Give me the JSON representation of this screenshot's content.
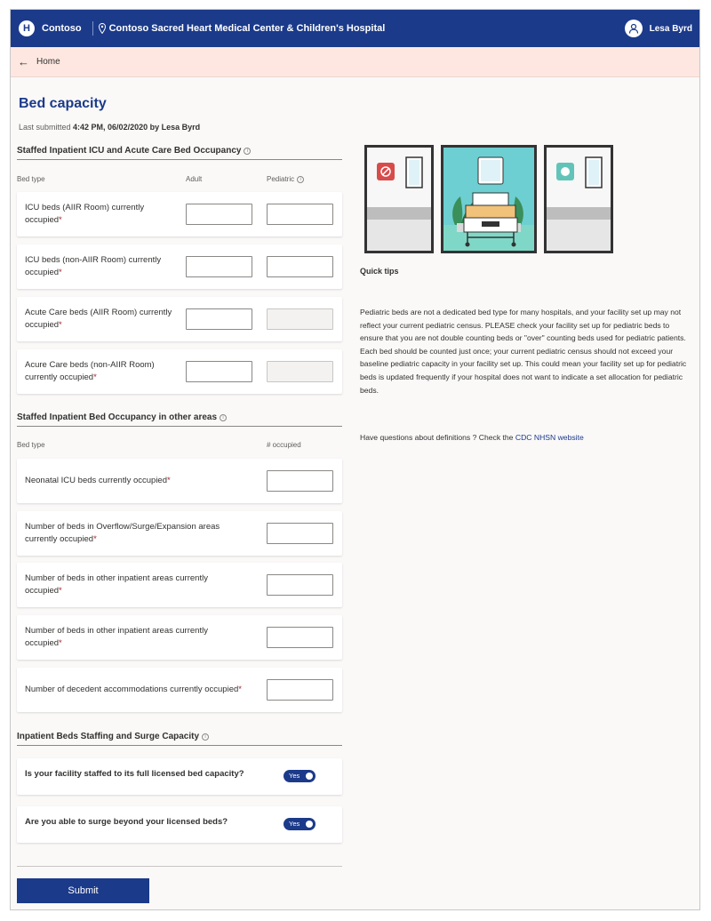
{
  "header": {
    "logo_letter": "H",
    "brand": "Contoso",
    "facility": "Contoso Sacred Heart Medical Center & Children's Hospital",
    "user_name": "Lesa Byrd"
  },
  "nav": {
    "home_label": "Home"
  },
  "page": {
    "title": "Bed capacity",
    "last_submitted_prefix": "Last submitted ",
    "last_submitted_value": "4:42 PM, 06/02/2020 by Lesa Byrd"
  },
  "section1": {
    "title": "Staffed Inpatient ICU and Acute Care Bed Occupancy",
    "col_bed_type": "Bed type",
    "col_adult": "Adult",
    "col_pediatric": "Pediatric",
    "rows": [
      {
        "label": "ICU beds (AIIR Room) currently occupied"
      },
      {
        "label": "ICU beds (non-AIIR Room) currently occupied"
      },
      {
        "label": "Acute Care beds (AIIR Room) currently occupied"
      },
      {
        "label": "Acure Care beds (non-AIIR Room) currently occupied"
      }
    ]
  },
  "section2": {
    "title": "Staffed Inpatient Bed Occupancy in other areas",
    "col_bed_type": "Bed type",
    "col_occupied": "# occupied",
    "rows": [
      {
        "label": "Neonatal ICU beds currently occupied"
      },
      {
        "label": "Number of beds in Overflow/Surge/Expansion areas currently occupied"
      },
      {
        "label": "Number of beds in other inpatient areas currently occupied"
      },
      {
        "label": "Number of beds in other inpatient areas currently occupied"
      },
      {
        "label": "Number of decedent accommodations currently occupied"
      }
    ]
  },
  "section3": {
    "title": "Inpatient Beds Staffing and Surge Capacity",
    "questions": [
      {
        "label": "Is your facility staffed to its full licensed bed capacity?",
        "toggle": "Yes"
      },
      {
        "label": "Are you able to surge beyond your licensed beds?",
        "toggle": "Yes"
      }
    ]
  },
  "required_mark": "*",
  "submit_label": "Submit",
  "tips": {
    "title": "Quick tips",
    "body": "Pediatric beds are not a dedicated bed type for many hospitals, and your facility set up may not reflect your current pediatric census. PLEASE check your facility set up for pediatric beds to ensure that you are not double counting beds or \"over\" counting beds used for pediatric patients. Each bed should be counted just once; your current pediatric census should not exceed your baseline pediatric capacity in your facility set up. This could mean your facility set up for pediatric beds is updated frequently if your hospital does not want to indicate a set allocation for pediatric beds.",
    "question_prefix": "Have questions about definitions ? Check the ",
    "link_label": "CDC NHSN website"
  },
  "colors": {
    "brand": "#1b3a8a",
    "nav_bg": "#fde7e0",
    "required": "#a4262c"
  }
}
